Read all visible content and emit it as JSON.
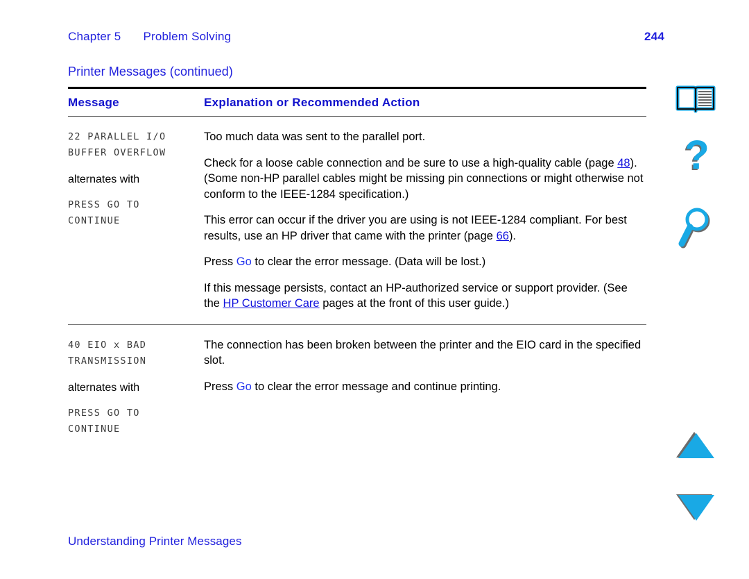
{
  "header": {
    "chapter_label": "Chapter 5",
    "chapter_title": "Problem Solving",
    "page_number": "244"
  },
  "table_title": "Printer Messages (continued)",
  "table": {
    "columns": {
      "message": "Message",
      "explanation": "Explanation or Recommended Action"
    },
    "rows": [
      {
        "message_lines_primary": "22 PARALLEL I/O\nBUFFER OVERFLOW",
        "alternates_label": "alternates with",
        "message_lines_secondary": "PRESS GO TO\nCONTINUE",
        "paragraphs": [
          {
            "parts": [
              {
                "text": "Too much data was sent to the parallel port.",
                "style": "plain"
              }
            ]
          },
          {
            "parts": [
              {
                "text": "Check for a loose cable connection and be sure to use a high-quality cable (page ",
                "style": "plain"
              },
              {
                "text": "48",
                "style": "link"
              },
              {
                "text": "). (Some non-HP parallel cables might be missing pin connections or might otherwise not conform to the IEEE-1284 specification.)",
                "style": "plain"
              }
            ]
          },
          {
            "parts": [
              {
                "text": "This error can occur if the driver you are using is not IEEE-1284 compliant. For best results, use an HP driver that came with the printer (page ",
                "style": "plain"
              },
              {
                "text": "66",
                "style": "link"
              },
              {
                "text": ").",
                "style": "plain"
              }
            ]
          },
          {
            "parts": [
              {
                "text": "Press ",
                "style": "plain"
              },
              {
                "text": "Go",
                "style": "keyword"
              },
              {
                "text": " to clear the error message. (Data will be lost.)",
                "style": "plain"
              }
            ]
          },
          {
            "parts": [
              {
                "text": "If this message persists, contact an HP-authorized service or support provider. (See the ",
                "style": "plain"
              },
              {
                "text": "HP Customer Care",
                "style": "link"
              },
              {
                "text": " pages at the front of this user guide.)",
                "style": "plain"
              }
            ]
          }
        ]
      },
      {
        "message_lines_primary": "40 EIO x BAD\nTRANSMISSION",
        "alternates_label": "alternates with",
        "message_lines_secondary": "PRESS GO TO\nCONTINUE",
        "paragraphs": [
          {
            "parts": [
              {
                "text": "The connection has been broken between the printer and the EIO card in the specified slot.",
                "style": "plain"
              }
            ]
          },
          {
            "parts": [
              {
                "text": "Press ",
                "style": "plain"
              },
              {
                "text": "Go",
                "style": "keyword"
              },
              {
                "text": " to clear the error message and continue printing.",
                "style": "plain"
              }
            ]
          }
        ]
      }
    ]
  },
  "nav_icons": [
    {
      "id": "icon-book",
      "name": "open-book-icon",
      "label": "Contents"
    },
    {
      "id": "icon-help",
      "name": "question-mark-icon",
      "label": "Help"
    },
    {
      "id": "icon-find",
      "name": "magnifying-glass-icon",
      "label": "Search"
    },
    {
      "id": "icon-up",
      "name": "triangle-up-icon",
      "label": "Previous page"
    },
    {
      "id": "icon-down",
      "name": "triangle-down-icon",
      "label": "Next page"
    }
  ],
  "footer": {
    "section_link": "Understanding Printer Messages"
  },
  "colors": {
    "heading_blue": "#2222dd",
    "link_blue": "#1111dd",
    "keyword_blue": "#2233ee",
    "icon_cyan": "#19a9e5",
    "icon_shadow": "#6b6b6b",
    "rule_black": "#000000"
  }
}
